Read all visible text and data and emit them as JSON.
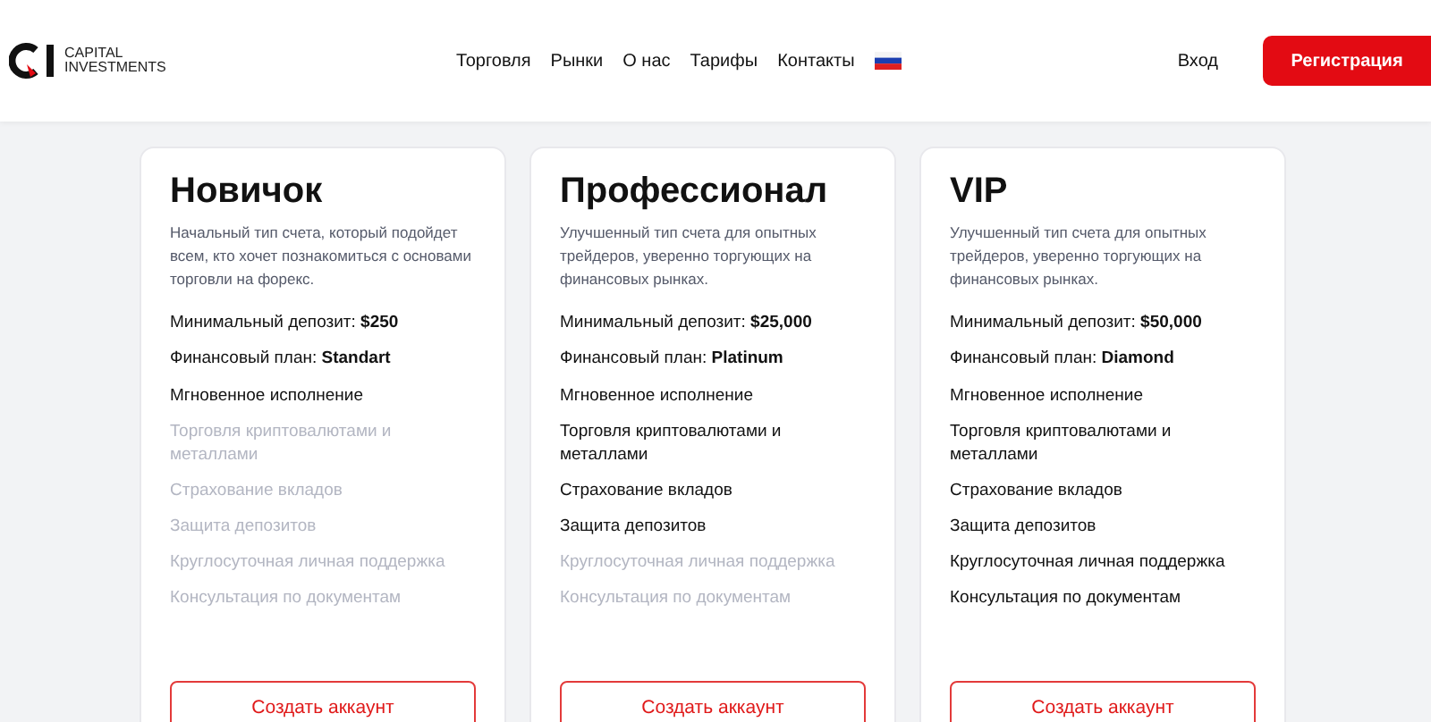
{
  "header": {
    "brand": [
      "CAPITAL",
      "INVESTMENTS"
    ],
    "nav": [
      "Торговля",
      "Рынки",
      "О нас",
      "Тарифы",
      "Контакты"
    ],
    "login": "Вход",
    "register": "Регистрация"
  },
  "plans": [
    {
      "title": "Новичок",
      "description": "Начальный тип счета, который подойдет всем, кто хочет познакомиться с основами торговли на форекс.",
      "deposit": "Минимальный депозит: **$250**",
      "plan": "Финансовый план: **Standart**",
      "features": [
        {
          "text": "Мгновенное исполнение",
          "included": true
        },
        {
          "text": "Торговля криптовалютами и металлами",
          "included": false
        },
        {
          "text": "Страхование вкладов",
          "included": false
        },
        {
          "text": "Защита депозитов",
          "included": false
        },
        {
          "text": "Круглосуточная личная поддержка",
          "included": false
        },
        {
          "text": "Консультация по документам",
          "included": false
        }
      ],
      "button": "Создать аккаунт"
    },
    {
      "title": "Профессионал",
      "description": "Улучшенный тип счета для опытных трейдеров, уверенно торгующих на финансовых рынках.",
      "deposit": "Минимальный депозит: **$25,000**",
      "plan": "Финансовый план: **Platinum**",
      "features": [
        {
          "text": "Мгновенное исполнение",
          "included": true
        },
        {
          "text": "Торговля криптовалютами и металлами",
          "included": true
        },
        {
          "text": "Страхование вкладов",
          "included": true
        },
        {
          "text": "Защита депозитов",
          "included": true
        },
        {
          "text": "Круглосуточная личная поддержка",
          "included": false
        },
        {
          "text": "Консультация по документам",
          "included": false
        }
      ],
      "button": "Создать аккаунт"
    },
    {
      "title": "VIP",
      "description": "Улучшенный тип счета для опытных трейдеров, уверенно торгующих на финансовых рынках.",
      "deposit": "Минимальный депозит: **$50,000**",
      "plan": "Финансовый план: **Diamond**",
      "features": [
        {
          "text": "Мгновенное исполнение",
          "included": true
        },
        {
          "text": "Торговля криптовалютами и металлами",
          "included": true
        },
        {
          "text": "Страхование вкладов",
          "included": true
        },
        {
          "text": "Защита депозитов",
          "included": true
        },
        {
          "text": "Круглосуточная личная поддержка",
          "included": true
        },
        {
          "text": "Консультация по документам",
          "included": true
        }
      ],
      "button": "Создать аккаунт"
    }
  ]
}
